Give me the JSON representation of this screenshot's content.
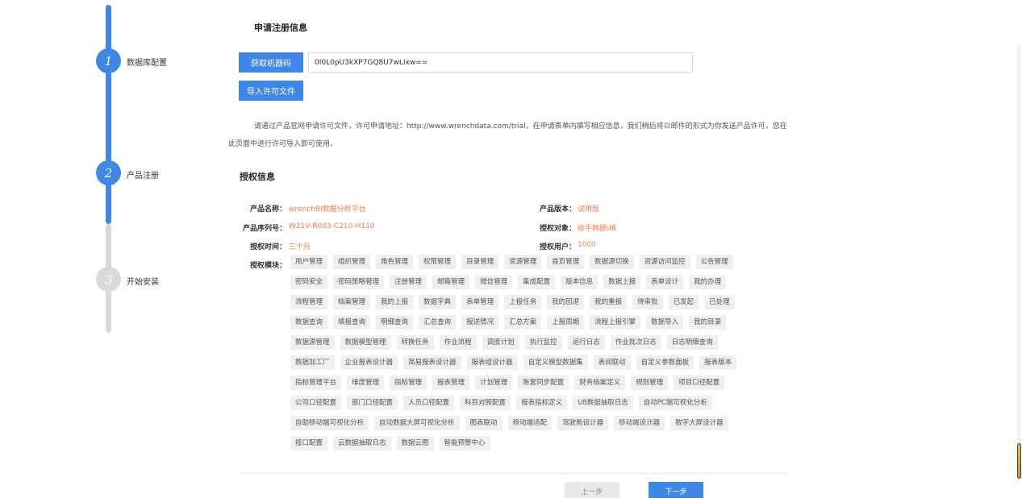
{
  "steps": [
    {
      "num": "1",
      "label": "数据库配置",
      "state": "done"
    },
    {
      "num": "2",
      "label": "产品注册",
      "state": "active"
    },
    {
      "num": "3",
      "label": "开始安装",
      "state": "pending"
    }
  ],
  "register": {
    "title": "申请注册信息",
    "get_code_label": "获取机器码",
    "machine_code": "0I0L0pU3kXP7GQ8U7wLIxw==",
    "import_label": "导入许可文件",
    "notice": "请通过产品官网申请许可文件，许可申请地址：http://www.wrenchdata.com/trial，在申请表单内填写相应信息，我们稍后将以邮件的形式为你发送产品许可，您在此页面中进行许可导入即可使用。"
  },
  "license": {
    "title": "授权信息",
    "product_name_label": "产品名称：",
    "product_name": "wrenchBI数据分析平台",
    "version_label": "产品版本：",
    "version": "试用版",
    "serial_label": "产品序列号：",
    "serial": "W21V-R003-C210-H110",
    "target_label": "授权对象：",
    "target": "扳手数据\\稀",
    "time_label": "授权时间：",
    "time": "三个月",
    "users_label": "授权用户：",
    "users": "1000",
    "modules_label": "授权模块：",
    "modules": [
      "用户管理",
      "组织管理",
      "角色管理",
      "权限管理",
      "目录管理",
      "资源管理",
      "首页管理",
      "数据源切换",
      "资源访问监控",
      "公告管理",
      "密码安全",
      "密码策略管理",
      "注册管理",
      "邮箱管理",
      "微信管理",
      "集成配置",
      "版本信息",
      "数据上报",
      "表单设计",
      "我的办理",
      "流程管理",
      "档案管理",
      "我的上报",
      "数据字典",
      "表单管理",
      "上报任务",
      "我的回退",
      "我的重报",
      "待审批",
      "已发起",
      "已处理",
      "数据查询",
      "填报查询",
      "明细查询",
      "汇总查询",
      "报送情况",
      "汇总方案",
      "上报周期",
      "流程上报引擎",
      "数据导入",
      "我的目录",
      "数据源管理",
      "数据模型管理",
      "转换任务",
      "作业流程",
      "调度计划",
      "执行监控",
      "运行日志",
      "作业批次日志",
      "日志明细查询",
      "数据加工厂",
      "企业报表设计器",
      "简易报表设计器",
      "报表组设计器",
      "自定义模型数据集",
      "表间联动",
      "自定义参数面板",
      "报表版本",
      "指标管理平台",
      "维度管理",
      "指标管理",
      "报表管理",
      "计划管理",
      "账套同步配置",
      "财务档案定义",
      "规则管理",
      "项目口径配置",
      "公司口径配置",
      "部门口径配置",
      "人员口径配置",
      "科目对照配置",
      "报表指标定义",
      "U8数据抽取日志",
      "自动PC端可视化分析",
      "自助移动端可视化分析",
      "自动数据大屏可视化分析",
      "图表联动",
      "移动端适配",
      "驾驶舱设计器",
      "移动端设计器",
      "数字大屏设计器",
      "接口配置",
      "云数据抽取日志",
      "数据云图",
      "智能预警中心"
    ]
  },
  "footer": {
    "prev_label": "上一步",
    "next_label": "下一步"
  }
}
